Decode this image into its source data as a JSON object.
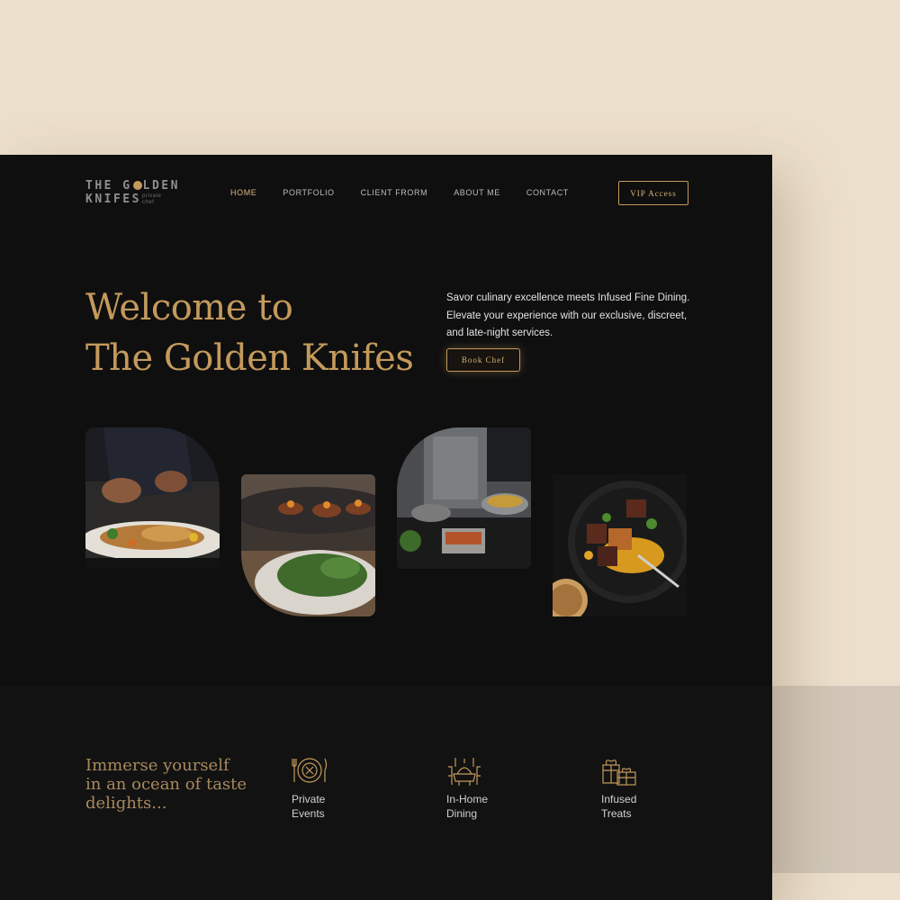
{
  "brand": {
    "line1_a": "THE G",
    "line1_b": "LDEN",
    "line2": "KNIFES",
    "sub_line1": "private",
    "sub_line2": "chef"
  },
  "nav": {
    "items": [
      {
        "label": "HOME",
        "active": true
      },
      {
        "label": "PORTFOLIO",
        "active": false
      },
      {
        "label": "CLIENT FRORM",
        "active": false
      },
      {
        "label": "ABOUT ME",
        "active": false
      },
      {
        "label": "CONTACT",
        "active": false
      }
    ],
    "vip_label": "VIP Access"
  },
  "hero": {
    "title_line1": "Welcome to",
    "title_line2": "The Golden Knifes",
    "description": "Savor culinary excellence meets Infused Fine Dining. Elevate your experience with our exclusive, discreet, and late-night services.",
    "cta_label": "Book Chef"
  },
  "gallery": [
    {
      "icon": "chef-plating-photo"
    },
    {
      "icon": "appetizers-photo"
    },
    {
      "icon": "kitchen-cooking-photo"
    },
    {
      "icon": "plated-dish-photo"
    }
  ],
  "features": {
    "tagline": "Immerse yourself in an ocean of taste delights...",
    "items": [
      {
        "icon": "dining-plate-icon",
        "label": "Private\nEvents"
      },
      {
        "icon": "dining-table-icon",
        "label": "In-Home\nDining"
      },
      {
        "icon": "gift-box-icon",
        "label": "Infused\nTreats"
      }
    ]
  },
  "colors": {
    "accent": "#c49a5c",
    "background": "#0f0f0f",
    "page": "#ecdfcc"
  }
}
